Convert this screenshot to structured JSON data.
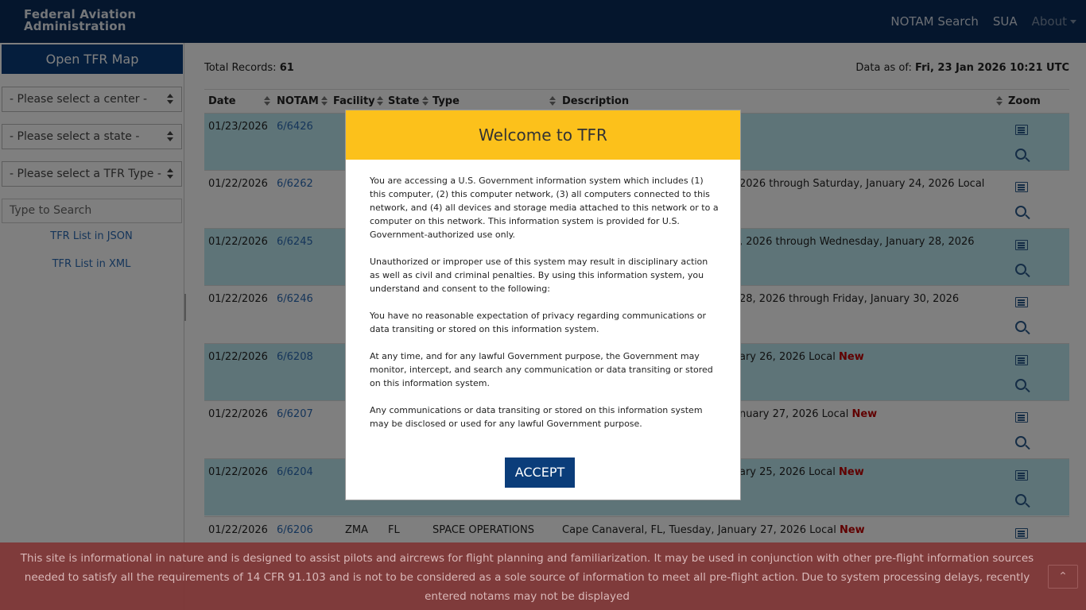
{
  "header": {
    "brand_line1": "Federal Aviation",
    "brand_line2": "Administration",
    "nav": [
      "NOTAM Search",
      "SUA",
      "About"
    ]
  },
  "sidebar": {
    "open_map": "Open TFR Map",
    "center_select": "- Please select a center -",
    "state_select": "- Please select a state -",
    "type_select": "- Please select a TFR Type -",
    "search_placeholder": "Type to Search",
    "link_json": "TFR List in JSON",
    "link_xml": "TFR List in XML"
  },
  "summary": {
    "total_label": "Total Records:",
    "total_value": "61",
    "data_as_of_label": "Data as of:",
    "data_as_of_value": "Fri, 23 Jan 2026 10:21 UTC"
  },
  "table": {
    "headers": [
      "Date",
      "NOTAM",
      "Facility",
      "State",
      "Type",
      "Description",
      "Zoom"
    ],
    "rows": [
      {
        "date": "01/23/2026",
        "notam": "6/6426",
        "facility": "",
        "state": "",
        "type": "",
        "description": "",
        "new": ""
      },
      {
        "date": "01/22/2026",
        "notam": "6/6262",
        "facility": "",
        "state": "",
        "type": "",
        "description": "2026 through Saturday, January 24, 2026 Local",
        "new": ""
      },
      {
        "date": "01/22/2026",
        "notam": "6/6245",
        "facility": "",
        "state": "",
        "type": "",
        "description": ", 2026 through Wednesday, January 28, 2026",
        "new": ""
      },
      {
        "date": "01/22/2026",
        "notam": "6/6246",
        "facility": "",
        "state": "",
        "type": "",
        "description": "28, 2026 through Friday, January 30, 2026",
        "new": ""
      },
      {
        "date": "01/22/2026",
        "notam": "6/6208",
        "facility": "",
        "state": "",
        "type": "",
        "description": "ary 26, 2026 Local",
        "new": "New"
      },
      {
        "date": "01/22/2026",
        "notam": "6/6207",
        "facility": "",
        "state": "",
        "type": "",
        "description": "nuary 27, 2026 Local",
        "new": "New"
      },
      {
        "date": "01/22/2026",
        "notam": "6/6204",
        "facility": "",
        "state": "",
        "type": "",
        "description": "ary 25, 2026 Local",
        "new": "New"
      },
      {
        "date": "01/22/2026",
        "notam": "6/6206",
        "facility": "ZMA",
        "state": "FL",
        "type": "SPACE OPERATIONS",
        "description": "Cape Canaveral, FL, Tuesday, January 27, 2026 Local",
        "new": "New"
      }
    ]
  },
  "modal": {
    "title": "Welcome to TFR",
    "paragraphs": [
      "You are accessing a U.S. Government information system which includes (1) this computer, (2) this computer network, (3) all computers connected to this network, and (4) all devices and storage media attached to this network or to a computer on this network. This information system is provided for U.S. Government-authorized use only.",
      "Unauthorized or improper use of this system may result in disciplinary action as well as civil and criminal penalties. By using this information system, you understand and consent to the following:",
      "You have no reasonable expectation of privacy regarding communications or data transiting or stored on this information system.",
      "At any time, and for any lawful Government purpose, the Government may monitor, intercept, and search any communication or data transiting or stored on this information system.",
      "Any communications or data transiting or stored on this information system may be disclosed or used for any lawful Government purpose."
    ],
    "accept_label": "ACCEPT"
  },
  "footer": {
    "text": "This site is informational in nature and is designed to assist pilots and aircrews for flight planning and familiarization. It may be used in conjunction with other pre-flight information sources needed to satisfy all the requirements of 14 CFR 91.103 and is not to be considered as a sole source of information to meet all pre-flight action. Due to system processing delays, recently entered notams may not be displayed",
    "back_to_top_icon": "chevron-up-icon"
  },
  "colors": {
    "header_bg": "#0b2d5a",
    "accent_blue": "#0b3d7a",
    "modal_header": "#fcc11b",
    "row_alt": "#bde9f1",
    "new_tag": "#c00000",
    "footer_bg": "#7f3535"
  }
}
